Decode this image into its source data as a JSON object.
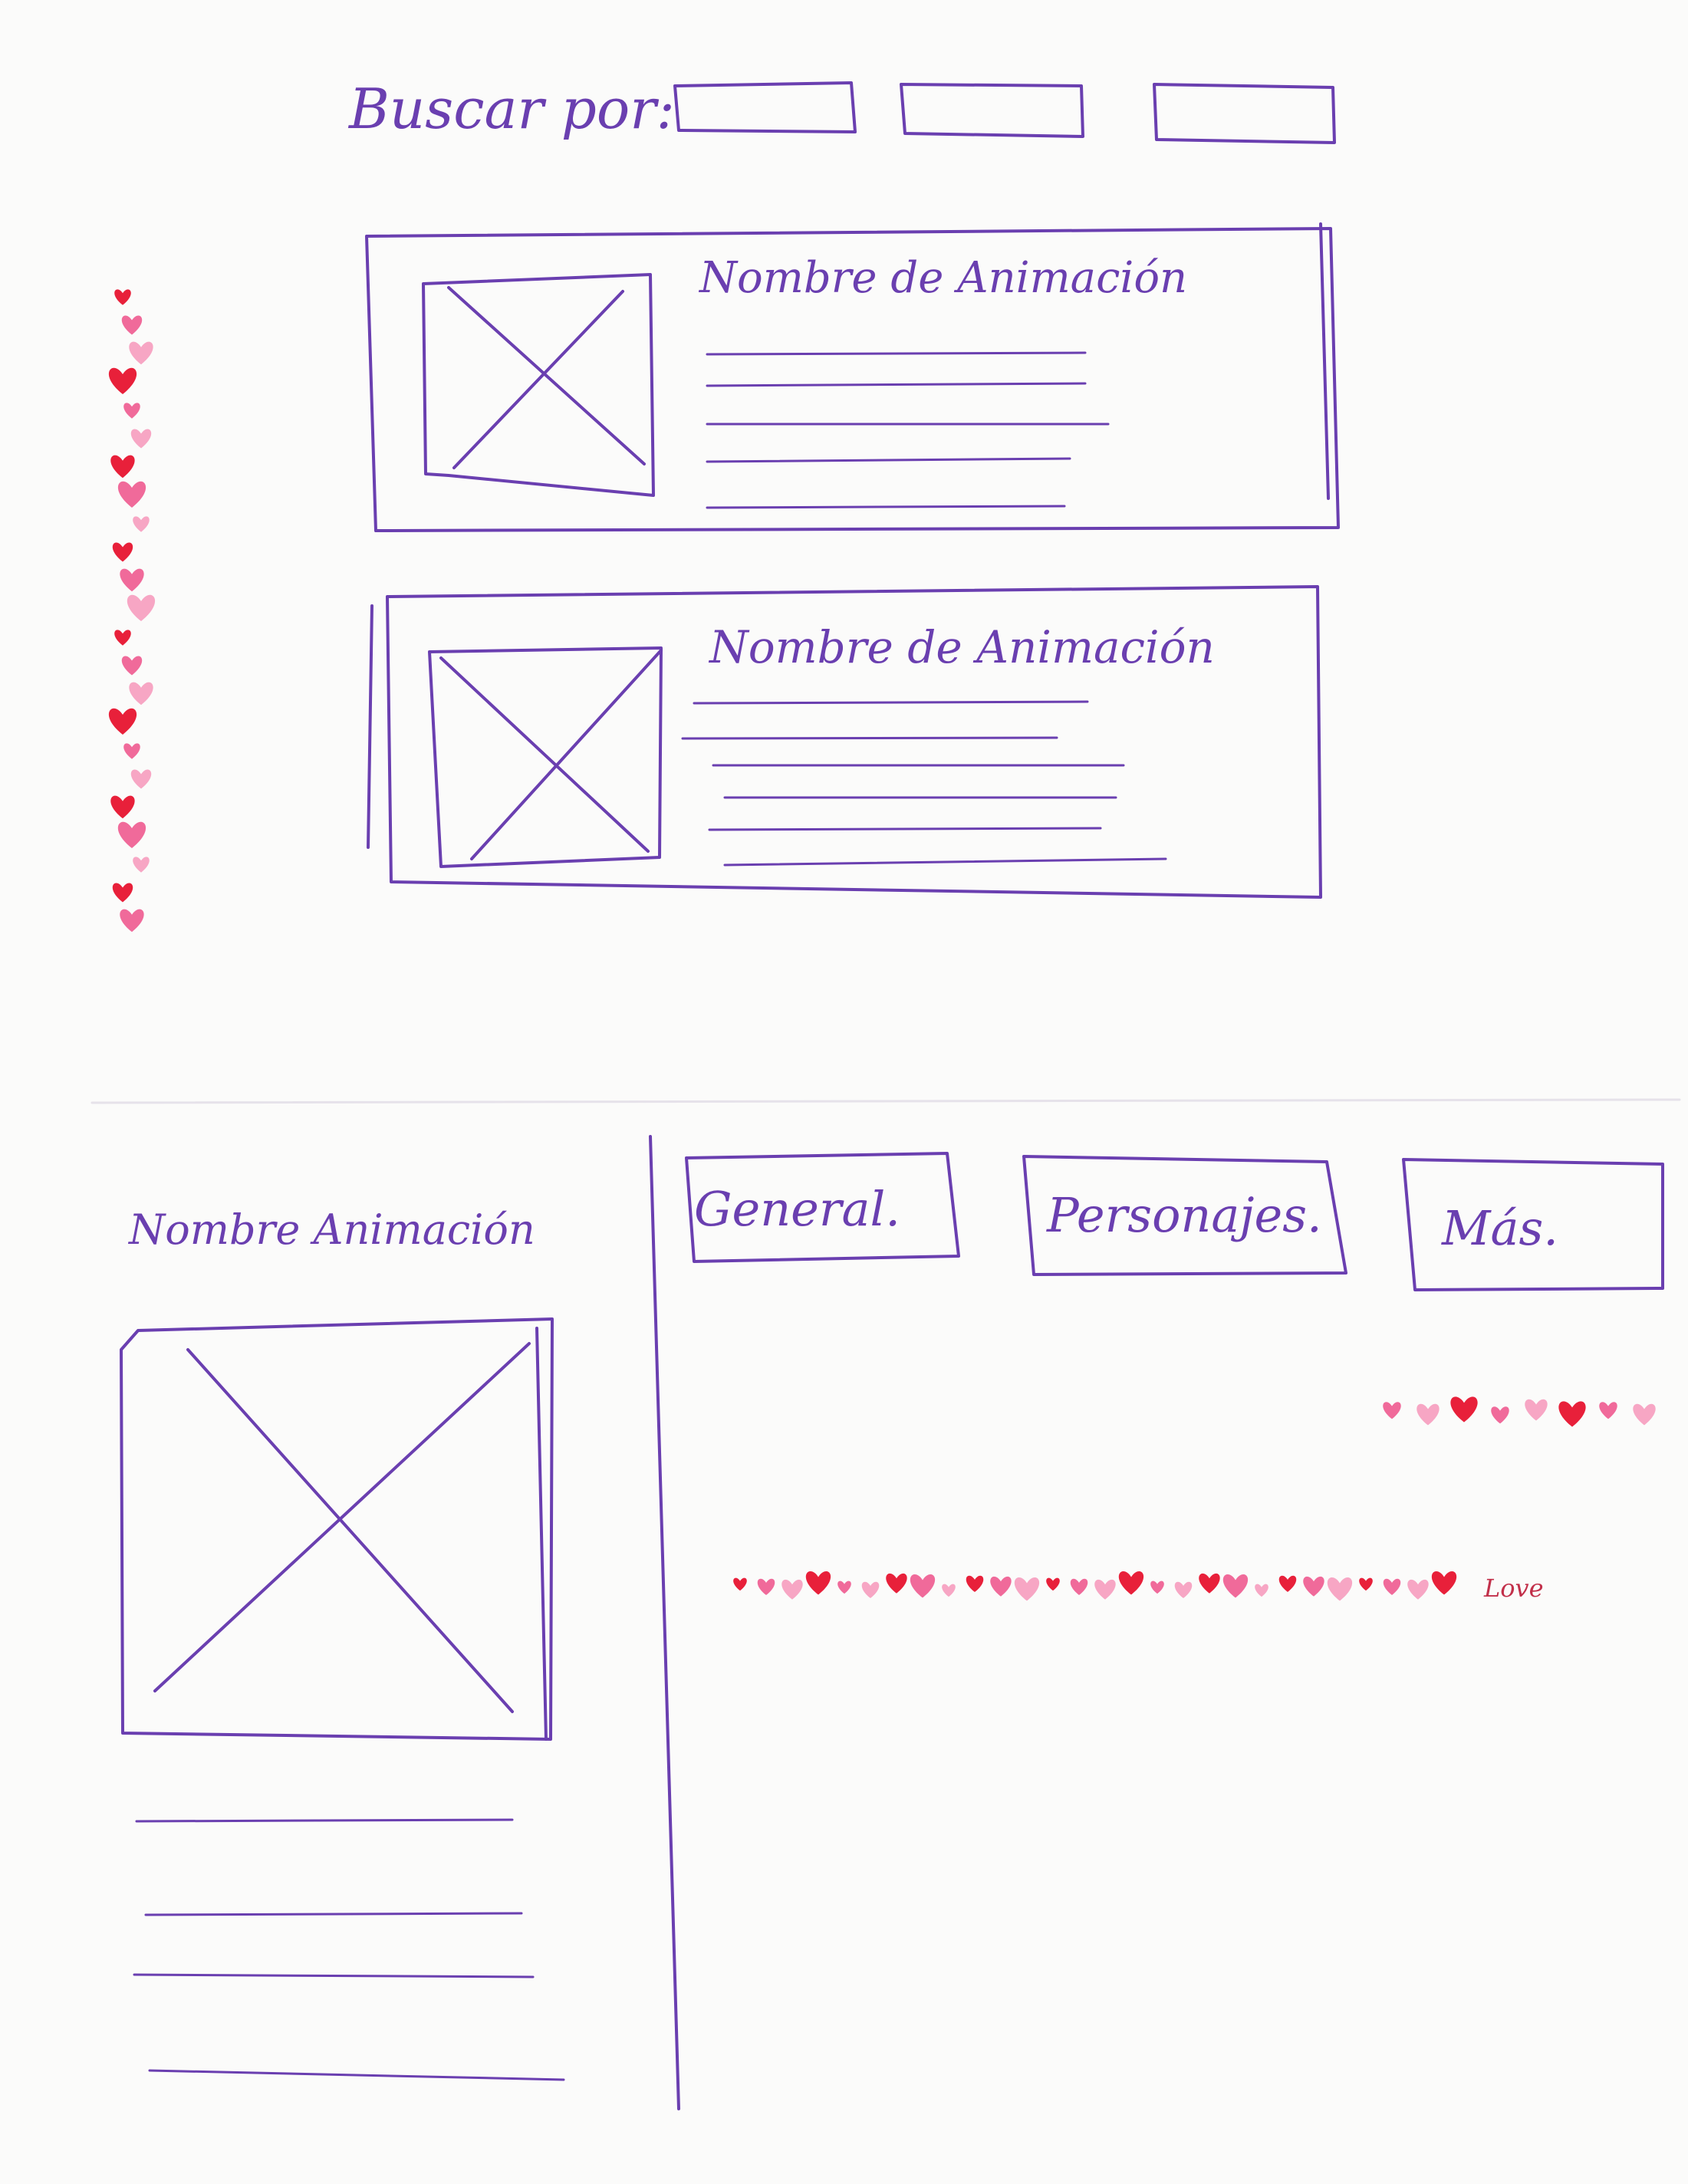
{
  "search": {
    "label": "Buscar por:",
    "fields": [
      "",
      "",
      ""
    ]
  },
  "results": [
    {
      "title": "Nombre de Animación"
    },
    {
      "title": "Nombre de Animación"
    }
  ],
  "detail": {
    "title": "Nombre Animación",
    "tabs": [
      {
        "label": "General."
      },
      {
        "label": "Personajes."
      },
      {
        "label": "Más."
      }
    ]
  },
  "decoration": {
    "tape_text": "Love",
    "ink_color": "#6a3fb0",
    "heart_colors": [
      "#e8203a",
      "#f06a9a",
      "#f7a6c4"
    ]
  }
}
